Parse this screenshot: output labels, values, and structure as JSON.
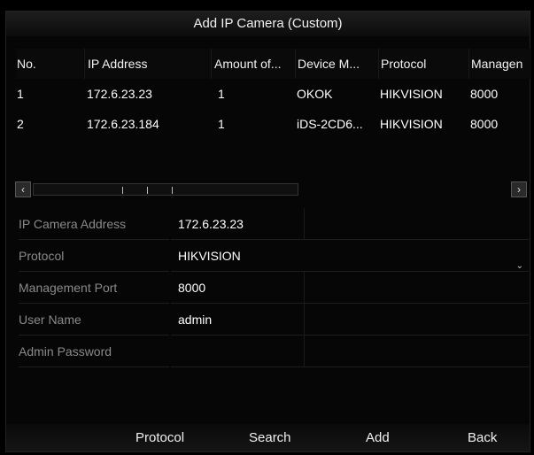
{
  "dialog": {
    "title": "Add IP Camera (Custom)"
  },
  "table": {
    "headers": [
      "No.",
      "IP Address",
      "Amount of...",
      "Device M...",
      "Protocol",
      "Managen"
    ],
    "rows": [
      [
        "1",
        "172.6.23.23",
        "1",
        "OKOK",
        "HIKVISION",
        "8000"
      ],
      [
        "2",
        "172.6.23.184",
        "1",
        "iDS-2CD6...",
        "HIKVISION",
        "8000"
      ]
    ]
  },
  "scrollbar": {
    "left_icon": "chevron-left-icon",
    "right_icon": "chevron-right-icon"
  },
  "form": {
    "ip_label": "IP Camera Address",
    "ip_value": "172.6.23.23",
    "protocol_label": "Protocol",
    "protocol_value": "HIKVISION",
    "port_label": "Management Port",
    "port_value": "8000",
    "user_label": "User Name",
    "user_value": "admin",
    "password_label": "Admin Password",
    "password_value": ""
  },
  "footer": {
    "protocol_label": "Protocol",
    "search_label": "Search",
    "add_label": "Add",
    "back_label": "Back"
  }
}
